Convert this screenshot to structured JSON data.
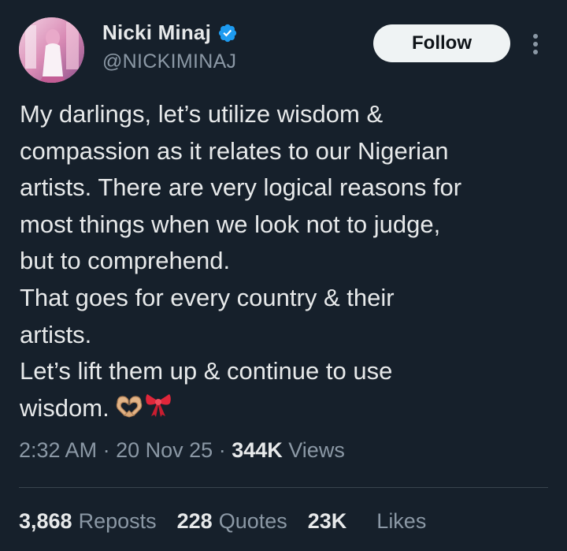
{
  "user": {
    "display_name": "Nicki Minaj",
    "handle": "@NICKIMINAJ",
    "verified": true
  },
  "actions": {
    "follow_label": "Follow",
    "more_icon": "more-vertical-icon"
  },
  "tweet": {
    "lines": [
      "My darlings, let’s utilize wisdom &",
      "compassion as it relates to our Nigerian",
      "artists. There are very logical reasons for",
      "most things when we look not to judge,",
      "but to comprehend.",
      "That goes for every country & their",
      "artists.",
      "Let’s lift them up & continue to use",
      "wisdom."
    ],
    "emojis": [
      "heart-hands-emoji",
      "ribbon-emoji"
    ]
  },
  "meta": {
    "time": "2:32 AM",
    "date": "20 Nov 25",
    "separator": "·",
    "views_count": "344K",
    "views_label": "Views"
  },
  "stats": {
    "reposts_count": "3,868",
    "reposts_label": "Reposts",
    "quotes_count": "228",
    "quotes_label": "Quotes",
    "likes_count": "23K",
    "likes_label": "Likes"
  },
  "colors": {
    "background": "#16202b",
    "text_primary": "#e7e9ea",
    "text_secondary": "#8b98a5",
    "verified_blue": "#1d9bf0",
    "follow_bg": "#eff3f4",
    "divider": "#38444d"
  }
}
